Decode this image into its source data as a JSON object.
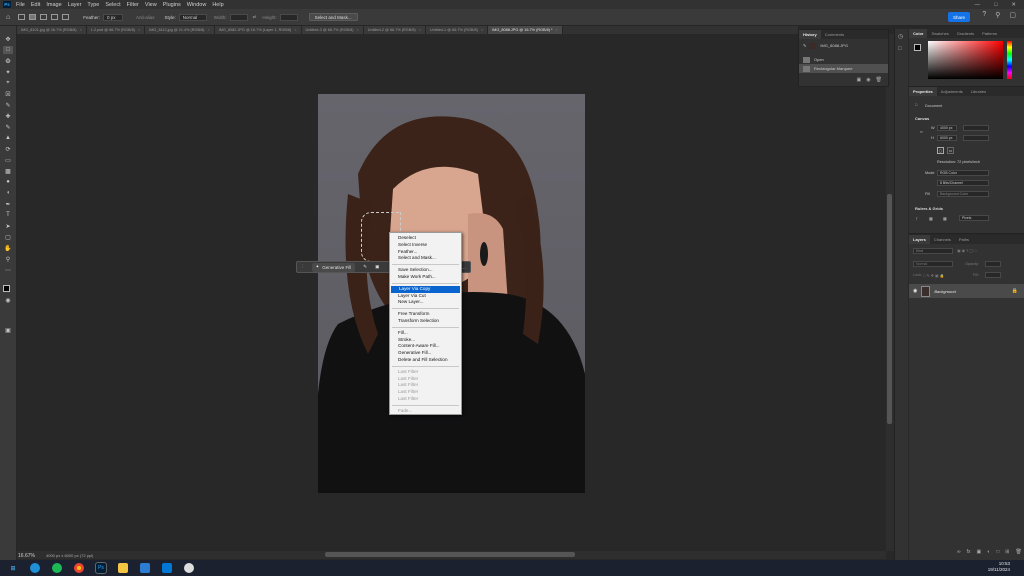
{
  "app": {
    "logo": "Ps"
  },
  "menubar": {
    "items": [
      "File",
      "Edit",
      "Image",
      "Layer",
      "Type",
      "Select",
      "Filter",
      "View",
      "Plugins",
      "Window",
      "Help"
    ]
  },
  "options": {
    "feather_label": "Feather:",
    "feather_value": "0 px",
    "anti_alias": "Anti-alias",
    "style_label": "Style:",
    "style_value": "Normal",
    "width_label": "Width:",
    "height_label": "Height:",
    "select_mask": "Select and Mask..."
  },
  "share_label": "Share",
  "tabs": [
    {
      "label": "IMG_8101.jpg @ 16.7% (RGB/8)",
      "active": false
    },
    {
      "label": "1.2.psd @ 66.7% (RGB/8)",
      "active": false
    },
    {
      "label": "IMG_8112.jpg @ 21.4% (RGB/8)",
      "active": false
    },
    {
      "label": "IMG_8082.JPG @ 16.7% (Layer 1, RGB/8)",
      "active": false
    },
    {
      "label": "Untitled-3 @ 66.7% (RGB/8)",
      "active": false
    },
    {
      "label": "Untitled-2 @ 66.7% (RGB/8)",
      "active": false
    },
    {
      "label": "Untitled-1 @ 66.7% (RGB/8)",
      "active": false
    },
    {
      "label": "IMG_8088.JPG @ 16.7% (RGB/8) *",
      "active": true
    }
  ],
  "history": {
    "tabs": [
      "History",
      "Comments"
    ],
    "snapshot": "IMG_8088.JPG",
    "items": [
      {
        "label": "Open",
        "selected": false
      },
      {
        "label": "Rectangular Marquee",
        "selected": true
      }
    ]
  },
  "color_panel": {
    "tabs": [
      "Color",
      "Swatches",
      "Gradients",
      "Patterns"
    ]
  },
  "properties": {
    "tabs": [
      "Properties",
      "Adjustments",
      "Libraries"
    ],
    "doc_label": "Document",
    "canvas_label": "Canvas",
    "w_label": "W",
    "w_value": "4000 px",
    "h_label": "H",
    "h_value": "6000 px",
    "resolution": "Resolution: 72 pixels/inch",
    "mode_label": "Mode",
    "mode_value": "RGB Color",
    "bits_value": "8 Bits/Channel",
    "fill_label": "Fill",
    "fill_value": "Background Color",
    "rulers_label": "Rulers & Grids",
    "units_value": "Pixels"
  },
  "layers": {
    "tabs": [
      "Layers",
      "Channels",
      "Paths"
    ],
    "search_placeholder": "Kind",
    "blend_mode": "Normal",
    "opacity_label": "Opacity:",
    "lock_label": "Lock:",
    "fill_label": "Fill:",
    "layer_name": "Background"
  },
  "context_bar": {
    "gen_fill": "Generative Fill"
  },
  "context_menu": {
    "groups": [
      [
        {
          "label": "Deselect"
        },
        {
          "label": "Select Inverse"
        },
        {
          "label": "Feather..."
        },
        {
          "label": "Select and Mask..."
        }
      ],
      [
        {
          "label": "Save Selection..."
        },
        {
          "label": "Make Work Path..."
        }
      ],
      [
        {
          "label": "Layer Via Copy",
          "highlighted": true
        },
        {
          "label": "Layer Via Cut"
        },
        {
          "label": "New Layer..."
        }
      ],
      [
        {
          "label": "Free Transform"
        },
        {
          "label": "Transform Selection"
        }
      ],
      [
        {
          "label": "Fill..."
        },
        {
          "label": "Stroke..."
        },
        {
          "label": "Content-Aware Fill..."
        },
        {
          "label": "Generative Fill..."
        },
        {
          "label": "Delete and Fill Selection"
        }
      ],
      [
        {
          "label": "Last Filter",
          "disabled": true
        },
        {
          "label": "Last Filter",
          "disabled": true
        },
        {
          "label": "Last Filter",
          "disabled": true
        },
        {
          "label": "Last Filter",
          "disabled": true
        },
        {
          "label": "Last Filter",
          "disabled": true
        }
      ],
      [
        {
          "label": "Fade...",
          "disabled": true
        }
      ]
    ]
  },
  "status": {
    "zoom": "16.67%",
    "dimensions": "4000 px x 6000 px (72 ppi)"
  },
  "clock": {
    "time": "10:53",
    "date": "19/11/2024"
  },
  "colors": {
    "accent": "#1473e6",
    "menu_highlight": "#0a64d0"
  }
}
